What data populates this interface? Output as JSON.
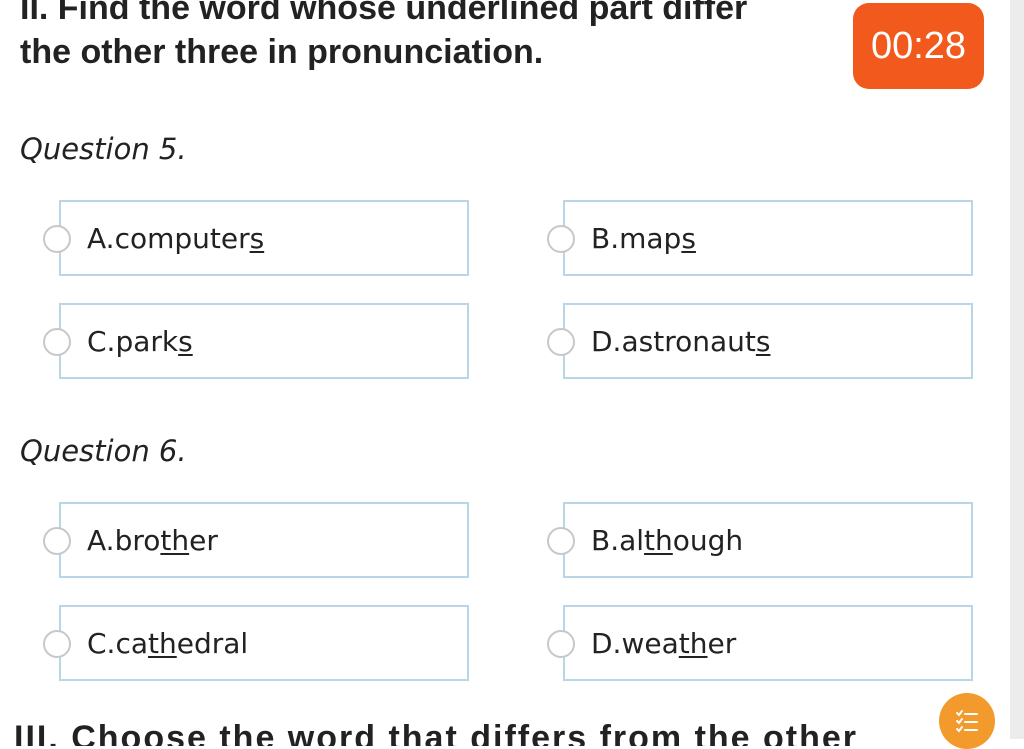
{
  "heading": {
    "line1": "II. Find the word whose underlined part differ",
    "line2": "the other three in pronunciation."
  },
  "timer": {
    "value": "00:28",
    "color": "#f25a1d"
  },
  "questions": [
    {
      "label": "Question 5.",
      "options": [
        {
          "prefix": "A. ",
          "pre": "computer",
          "under": "s",
          "post": ""
        },
        {
          "prefix": "B. ",
          "pre": "map",
          "under": "s",
          "post": ""
        },
        {
          "prefix": "C. ",
          "pre": "park",
          "under": "s",
          "post": ""
        },
        {
          "prefix": "D. ",
          "pre": "astronaut",
          "under": "s",
          "post": ""
        }
      ]
    },
    {
      "label": "Question 6.",
      "options": [
        {
          "prefix": "A. ",
          "pre": "bro",
          "under": "th",
          "post": "er"
        },
        {
          "prefix": "B. ",
          "pre": "al",
          "under": "th",
          "post": "ough"
        },
        {
          "prefix": "C. ",
          "pre": "ca",
          "under": "th",
          "post": "edral"
        },
        {
          "prefix": "D. ",
          "pre": "wea",
          "under": "th",
          "post": "er"
        }
      ]
    }
  ],
  "next_section_partial": "III. Choose the word that differs from the other three",
  "menu_button": {
    "icon": "list-icon",
    "color": "#f39a2c"
  }
}
